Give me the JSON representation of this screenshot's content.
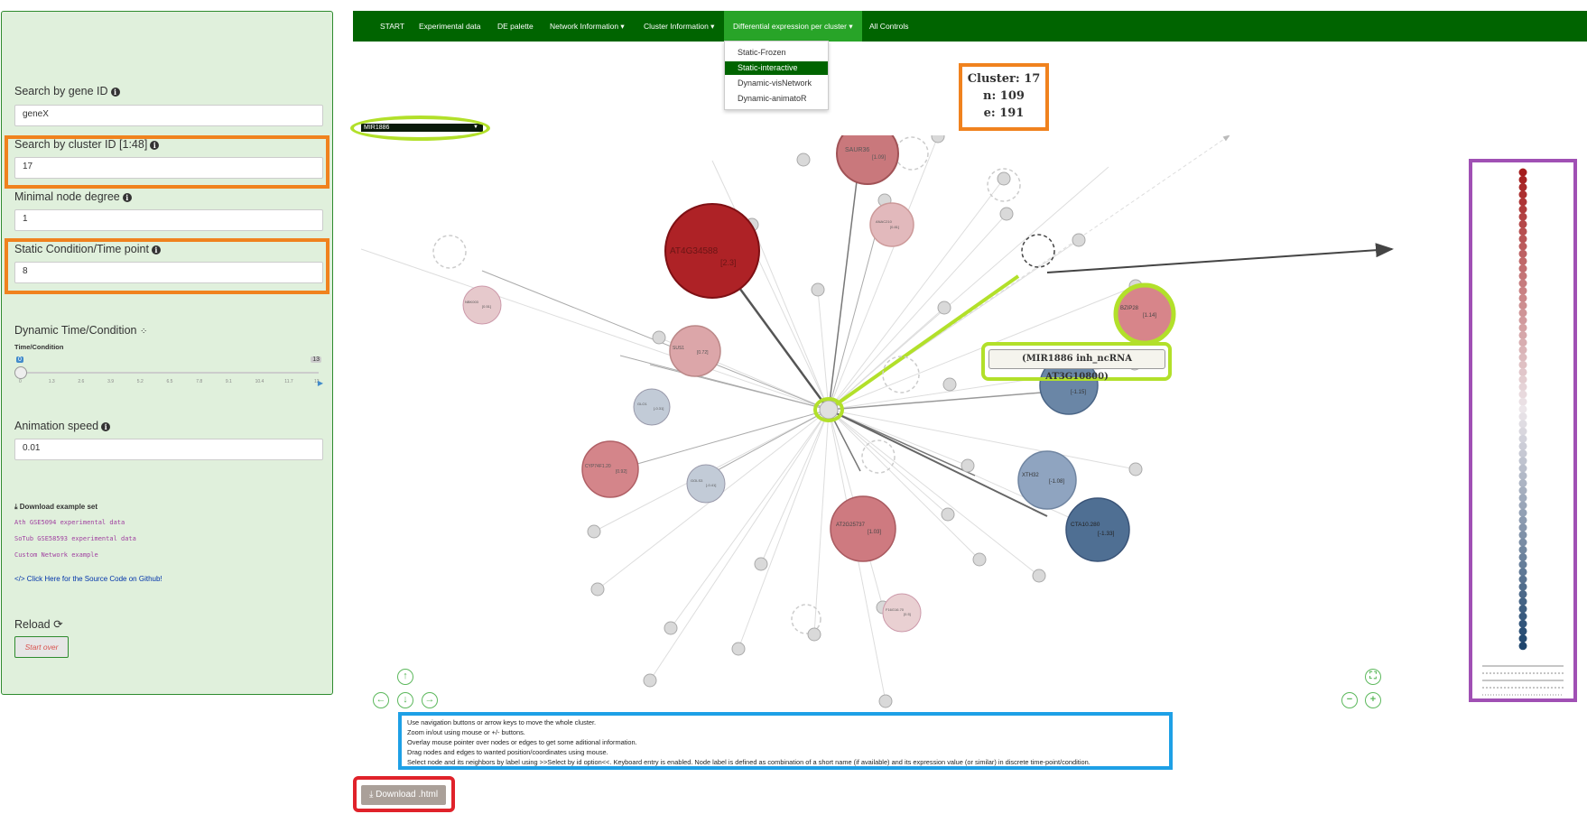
{
  "sidebar": {
    "gene_search": {
      "label": "Search by gene ID",
      "value": "geneX"
    },
    "cluster_search": {
      "label": "Search by cluster ID [1:48]",
      "value": "17"
    },
    "min_degree": {
      "label": "Minimal node degree",
      "value": "1"
    },
    "static_condition": {
      "label": "Static Condition/Time point",
      "value": "8"
    },
    "dynamic": {
      "label": "Dynamic Time/Condition",
      "slider_label": "Time/Condition",
      "min": "0",
      "max": "13",
      "current": "0",
      "ticks": [
        "0",
        "1.3",
        "2.6",
        "3.9",
        "5.2",
        "6.5",
        "7.8",
        "9.1",
        "10.4",
        "11.7",
        "13"
      ]
    },
    "animation_speed": {
      "label": "Animation speed",
      "value": "0.01"
    },
    "download_example_label": "Download example set",
    "example_links": [
      "Ath GSE5094 experimental data",
      "SoTub GSE58593 experimental data",
      "Custom Network example"
    ],
    "github_link": "</> Click Here for the Source Code on Github!",
    "reload_label": "Reload",
    "start_over_label": "Start over"
  },
  "navbar": {
    "items": [
      "START",
      "Experimental data",
      "DE palette",
      "Network Information ▾",
      "Cluster Information ▾",
      "Differential expression per cluster ▾",
      "All Controls"
    ],
    "active_index": 5
  },
  "dropdown": {
    "items": [
      "Static-Frozen",
      "Static-interactive",
      "Dynamic-visNetwork",
      "Dynamic-animatoR"
    ],
    "selected_index": 1
  },
  "stats": {
    "cluster": "Cluster: 17",
    "n": "n: 109",
    "e": "e: 191"
  },
  "select_by_id": {
    "value": "MIR1886",
    "arrow": "▼"
  },
  "network": {
    "tooltip": "(MIR1886 inh_ncRNA AT3G10800)",
    "node_labels": [
      {
        "name": "SAUR36",
        "value": "[1.09]"
      },
      {
        "name": "ANAC210",
        "value": "[0.81]"
      },
      {
        "name": "AT4G34588",
        "value": "[2.3]"
      },
      {
        "name": "SUS1",
        "value": "[0.72]"
      },
      {
        "name": "NBK003",
        "value": "[0.51]"
      },
      {
        "name": "GLO1",
        "value": "[-0.31]"
      },
      {
        "name": "CYP74F1.20",
        "value": "[0.92]"
      },
      {
        "name": "GOLS3",
        "value": "[-0.41]"
      },
      {
        "name": "BZIP28",
        "value": "[1.14]"
      },
      {
        "name": "",
        "value": "[-1.15]"
      },
      {
        "name": "XTH32",
        "value": "[-1.08]"
      },
      {
        "name": "CTA10.280",
        "value": "[-1.33]"
      },
      {
        "name": "AT2G25737",
        "value": "[1.03]"
      },
      {
        "name": "F16G16.70",
        "value": "[0.5]"
      }
    ]
  },
  "help_lines": [
    "Use navigation buttons or arrow keys to move the whole cluster.",
    "Zoom in/out using mouse or +/- buttons.",
    "Overlay mouse pointer over nodes or edges to get some aditional information.",
    "Drag nodes and edges to wanted position/coordinates using mouse.",
    "Select node and its neighbors by label using >>Select by id option<<. Keyboard entry is enabled. Node label is defined as combination of a short name (if available) and its expression value (or similar) in discrete time-point/condition."
  ],
  "download_html_label": "Download .html",
  "legend": {
    "colors": {
      "high": "#a51c1c",
      "mid": "#ece6ea",
      "low": "#1f466e"
    },
    "edge_types": [
      "activation",
      "inhibition",
      "binding",
      "unknown",
      "other"
    ]
  }
}
